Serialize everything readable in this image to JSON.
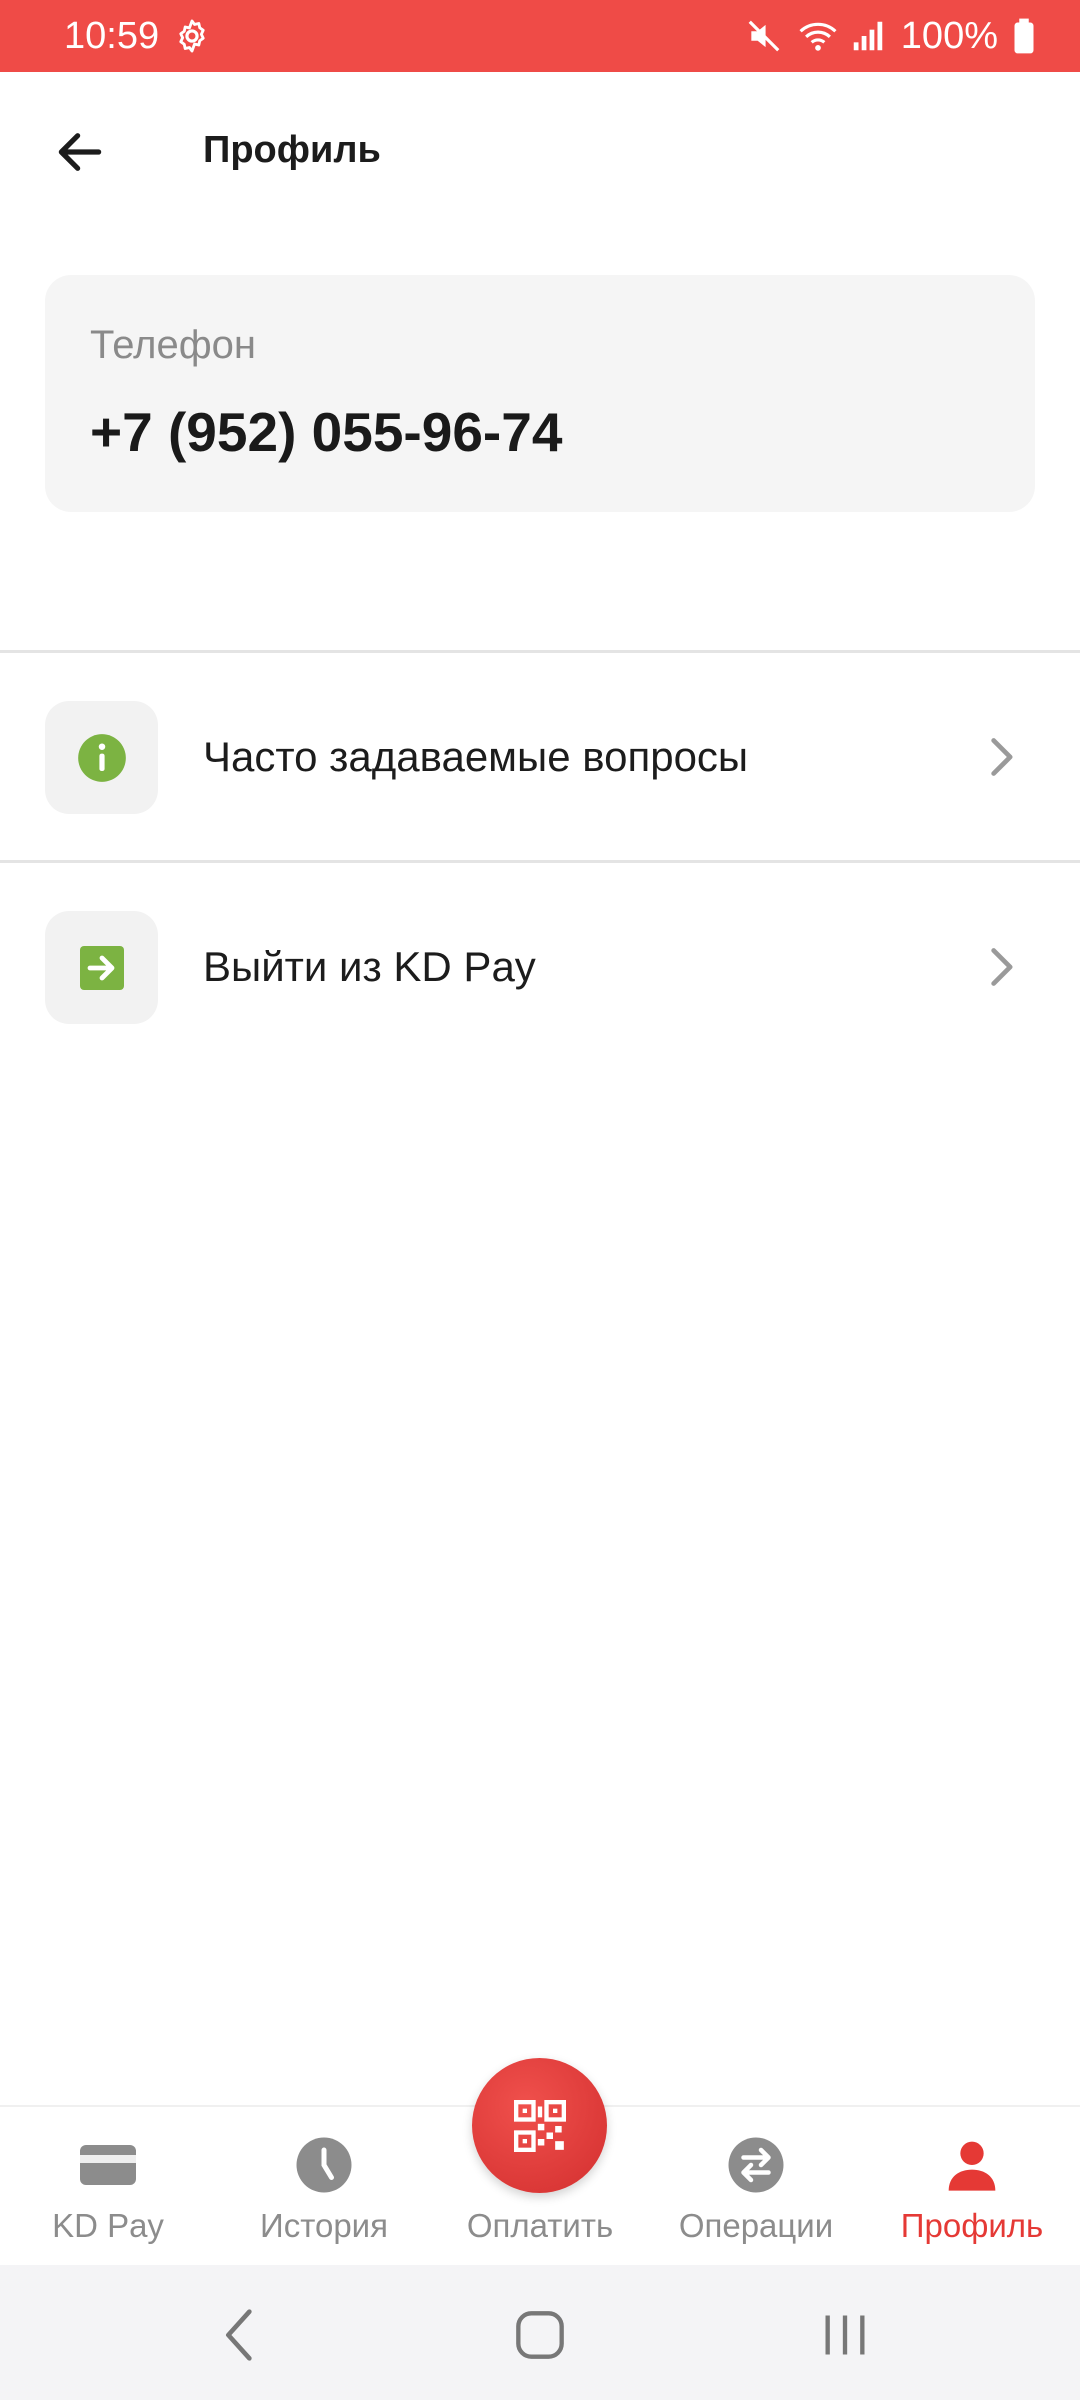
{
  "status_bar": {
    "time": "10:59",
    "battery": "100%",
    "icons": [
      "settings-gear-icon",
      "mute-icon",
      "wifi-icon",
      "signal-icon",
      "battery-icon"
    ]
  },
  "header": {
    "title": "Профиль",
    "back_icon": "arrow-left-icon"
  },
  "phone": {
    "label": "Телефон",
    "value": "+7 (952) 055-96-74"
  },
  "menu": {
    "items": [
      {
        "label": "Часто задаваемые вопросы",
        "icon": "info-icon",
        "icon_color": "#7cb342"
      },
      {
        "label": "Выйти из KD Pay",
        "icon": "logout-icon",
        "icon_color": "#7cb342"
      }
    ]
  },
  "bottom_nav": {
    "items": [
      {
        "label": "KD Pay",
        "icon": "card-icon"
      },
      {
        "label": "История",
        "icon": "clock-icon"
      },
      {
        "label": "Оплатить",
        "icon": "qr-code-icon"
      },
      {
        "label": "Операции",
        "icon": "transfer-icon"
      },
      {
        "label": "Профиль",
        "icon": "user-icon",
        "active": true
      }
    ],
    "active_color": "#e53935",
    "inactive_color": "#8c8c8c"
  },
  "colors": {
    "status_bar": "#ef4b47",
    "accent": "#e53935",
    "green": "#7cb342"
  }
}
